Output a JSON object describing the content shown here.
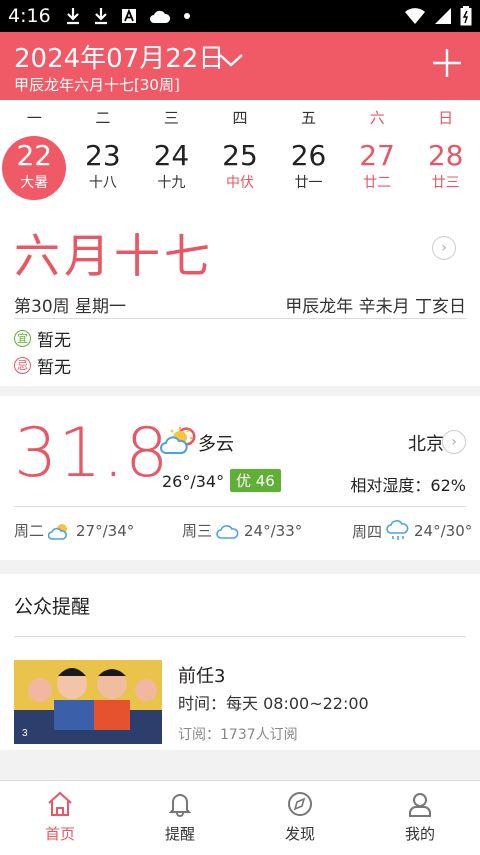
{
  "status": {
    "time": "4:16"
  },
  "header": {
    "date": "2024年07月22日",
    "lunar": "甲辰龙年六月十七[30周]"
  },
  "weekdays": [
    "一",
    "二",
    "三",
    "四",
    "五",
    "六",
    "日"
  ],
  "days": [
    {
      "num": "22",
      "sub": "大暑"
    },
    {
      "num": "23",
      "sub": "十八"
    },
    {
      "num": "24",
      "sub": "十九"
    },
    {
      "num": "25",
      "sub": "中伏"
    },
    {
      "num": "26",
      "sub": "廿一"
    },
    {
      "num": "27",
      "sub": "廿二"
    },
    {
      "num": "28",
      "sub": "廿三"
    }
  ],
  "info": {
    "lunar_big": "六月十七",
    "week_line": "第30周   星期一",
    "ganzhi": "甲辰龙年 辛未月 丁亥日",
    "yi_badge": "宜",
    "yi": "暂无",
    "ji_badge": "忌",
    "ji": "暂无"
  },
  "weather": {
    "temp": "31.8°",
    "condition": "多云",
    "city": "北京",
    "range": "26°/34°",
    "aqi": "优 46",
    "humidity": "相对湿度：62%",
    "forecast": [
      {
        "day": "周二",
        "temp": "27°/34°",
        "icon": "partly-cloudy-icon"
      },
      {
        "day": "周三",
        "temp": "24°/33°",
        "icon": "cloud-icon"
      },
      {
        "day": "周四",
        "temp": "24°/30°",
        "icon": "rain-icon"
      }
    ]
  },
  "notice": {
    "title": "公众提醒",
    "show_title": "前任3",
    "show_time": "时间：每天 08:00~22:00",
    "show_sub": "订阅：1737人订阅"
  },
  "tabs": [
    {
      "label": "首页",
      "icon": "home-icon"
    },
    {
      "label": "提醒",
      "icon": "bell-icon"
    },
    {
      "label": "发现",
      "icon": "compass-icon"
    },
    {
      "label": "我的",
      "icon": "user-icon"
    }
  ],
  "colors": {
    "accent": "#f05a67",
    "text_red": "#e85765",
    "aqi_green": "#5fb035"
  }
}
